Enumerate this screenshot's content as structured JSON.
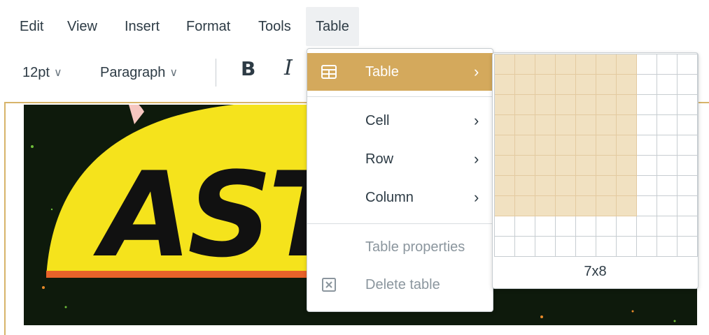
{
  "menubar": {
    "items": [
      {
        "label": "Edit"
      },
      {
        "label": "View"
      },
      {
        "label": "Insert"
      },
      {
        "label": "Format"
      },
      {
        "label": "Tools"
      },
      {
        "label": "Table"
      }
    ]
  },
  "toolbar": {
    "font_size": "12pt",
    "block_format": "Paragraph",
    "bold_label": "B",
    "italic_label": "I"
  },
  "editor_image": {
    "text": "ASTR",
    "colors": {
      "background": "#0e1a0c",
      "banner": "#f5e31c",
      "stripe": "#e8622a"
    }
  },
  "table_menu": {
    "items": [
      {
        "label": "Table",
        "icon": "table-icon",
        "submenu": true,
        "highlighted": true
      },
      {
        "label": "Cell",
        "submenu": true
      },
      {
        "label": "Row",
        "submenu": true
      },
      {
        "label": "Column",
        "submenu": true
      },
      {
        "label": "Table properties",
        "disabled": true
      },
      {
        "label": "Delete table",
        "icon": "delete-table-icon",
        "disabled": true
      }
    ]
  },
  "grid_picker": {
    "rows_total": 10,
    "cols_total": 10,
    "selected_cols": 7,
    "selected_rows": 8,
    "size_label": "7x8"
  },
  "colors": {
    "accent": "#d4a95c",
    "selection": "#f1e1c1",
    "border": "#c7cdd1",
    "text": "#2d3b45",
    "disabled_text": "#8b969e"
  }
}
